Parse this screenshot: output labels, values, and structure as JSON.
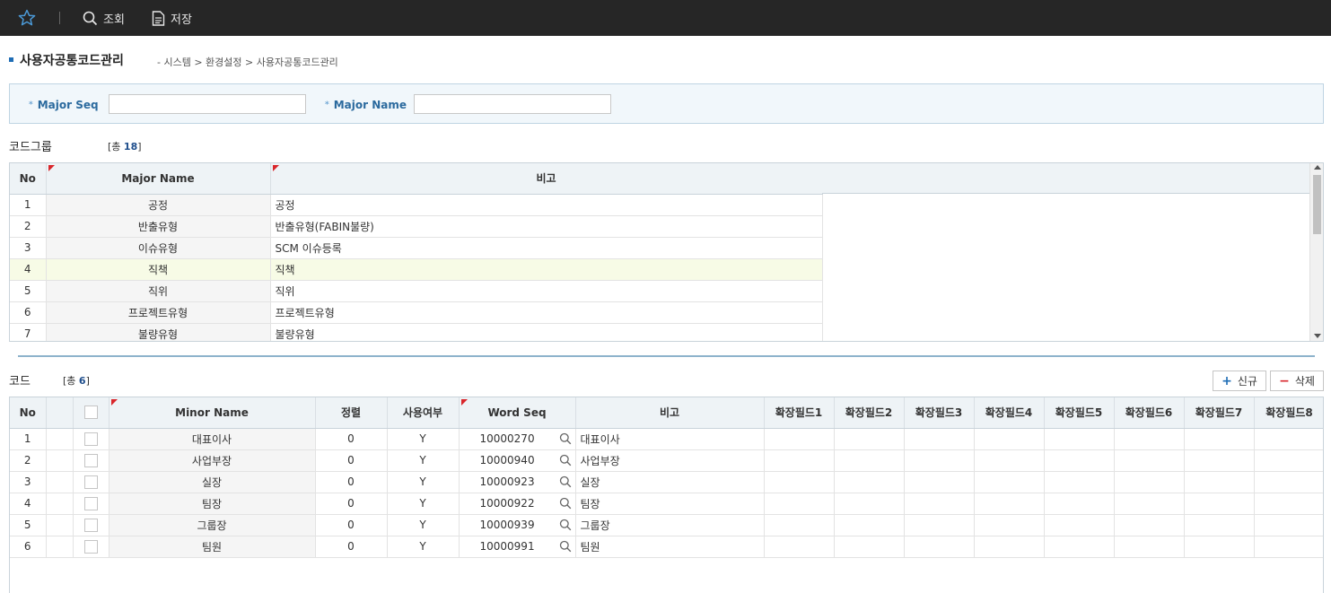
{
  "toolbar": {
    "search_label": "조회",
    "save_label": "저장"
  },
  "page": {
    "title": "사용자공통코드관리",
    "breadcrumb": "- 시스템 > 환경설정 > 사용자공통코드관리"
  },
  "search": {
    "major_seq_label": "Major Seq",
    "major_seq_value": "",
    "major_name_label": "Major Name",
    "major_name_value": ""
  },
  "code_group": {
    "title": "코드그룹",
    "count_prefix": "[총 ",
    "count": "18",
    "count_suffix": "]",
    "headers": [
      "No",
      "Major Name",
      "비고"
    ],
    "rows": [
      {
        "no": "1",
        "major_name": "공정",
        "remark": "공정"
      },
      {
        "no": "2",
        "major_name": "반출유형",
        "remark": "반출유형(FABIN불량)"
      },
      {
        "no": "3",
        "major_name": "이슈유형",
        "remark": "SCM 이슈등록"
      },
      {
        "no": "4",
        "major_name": "직책",
        "remark": "직책"
      },
      {
        "no": "5",
        "major_name": "직위",
        "remark": "직위"
      },
      {
        "no": "6",
        "major_name": "프로젝트유형",
        "remark": "프로젝트유형"
      },
      {
        "no": "7",
        "major_name": "불량유형",
        "remark": "불량유형"
      }
    ],
    "selected_row": 4
  },
  "code": {
    "title": "코드",
    "count_prefix": "[총 ",
    "count": "6",
    "count_suffix": "]",
    "new_button": "신규",
    "delete_button": "삭제",
    "headers": [
      "No",
      "Minor Name",
      "정렬",
      "사용여부",
      "Word Seq",
      "비고",
      "확장필드1",
      "확장필드2",
      "확장필드3",
      "확장필드4",
      "확장필드5",
      "확장필드6",
      "확장필드7",
      "확장필드8"
    ],
    "rows": [
      {
        "no": "1",
        "minor_name": "대표이사",
        "sort": "0",
        "use": "Y",
        "word_seq": "10000270",
        "remark": "대표이사"
      },
      {
        "no": "2",
        "minor_name": "사업부장",
        "sort": "0",
        "use": "Y",
        "word_seq": "10000940",
        "remark": "사업부장"
      },
      {
        "no": "3",
        "minor_name": "실장",
        "sort": "0",
        "use": "Y",
        "word_seq": "10000923",
        "remark": "실장"
      },
      {
        "no": "4",
        "minor_name": "팀장",
        "sort": "0",
        "use": "Y",
        "word_seq": "10000922",
        "remark": "팀장"
      },
      {
        "no": "5",
        "minor_name": "그룹장",
        "sort": "0",
        "use": "Y",
        "word_seq": "10000939",
        "remark": "그룹장"
      },
      {
        "no": "6",
        "minor_name": "팀원",
        "sort": "0",
        "use": "Y",
        "word_seq": "10000991",
        "remark": "팀원"
      }
    ]
  },
  "colors": {
    "toolbar_bg": "#262626",
    "accent": "#1f6db5",
    "required_marker": "#d9262b",
    "selected_row": "#f7fbe6"
  }
}
